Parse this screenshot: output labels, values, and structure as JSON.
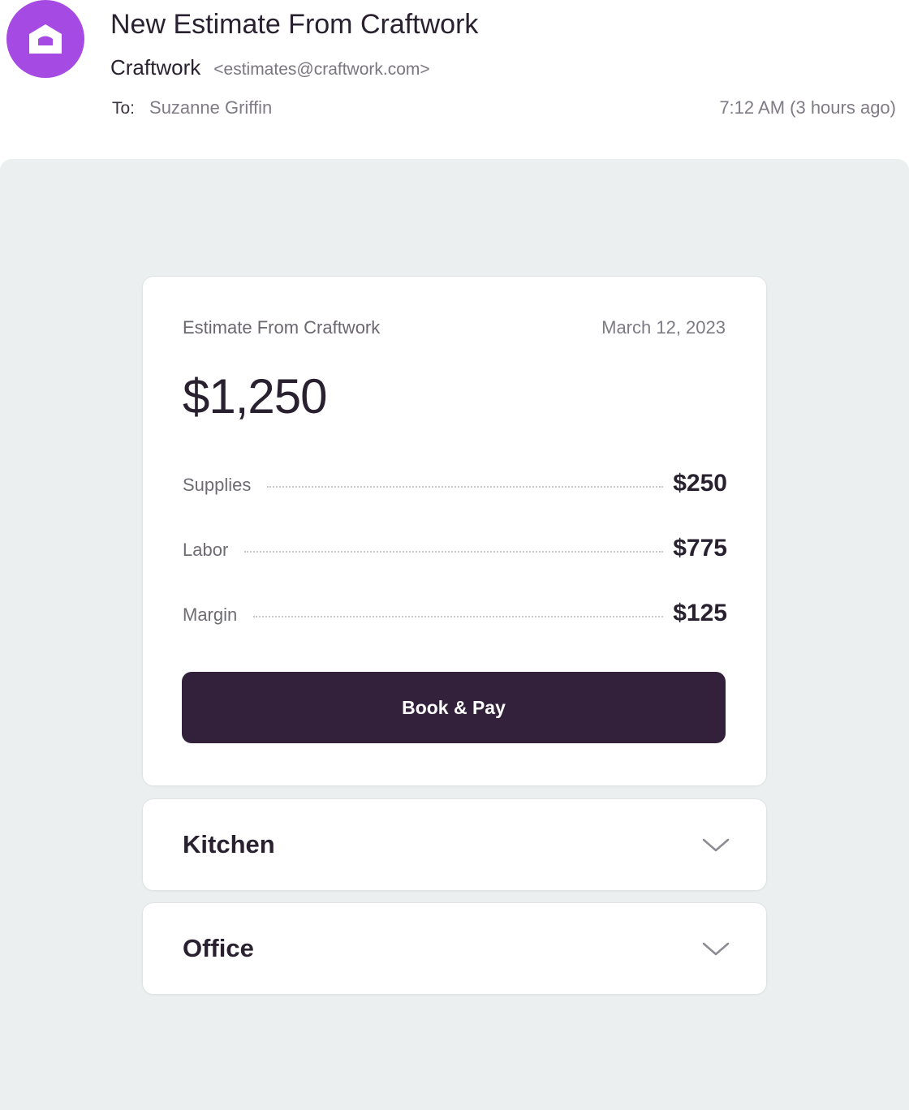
{
  "email": {
    "subject": "New Estimate From Craftwork",
    "sender_name": "Craftwork",
    "sender_email": "<estimates@craftwork.com>",
    "to_label": "To:",
    "to_name": "Suzanne Griffin",
    "timestamp": "7:12 AM (3 hours ago)",
    "avatar_icon": "house-icon",
    "avatar_color": "#a54be3"
  },
  "estimate": {
    "title": "Estimate From Craftwork",
    "date": "March 12, 2023",
    "total": "$1,250",
    "line_items": [
      {
        "label": "Supplies",
        "amount": "$250"
      },
      {
        "label": "Labor",
        "amount": "$775"
      },
      {
        "label": "Margin",
        "amount": "$125"
      }
    ],
    "button_label": "Book & Pay",
    "button_color": "#33203a"
  },
  "sections": [
    {
      "title": "Kitchen",
      "icon": "chevron-down-icon"
    },
    {
      "title": "Office",
      "icon": "chevron-down-icon"
    }
  ]
}
